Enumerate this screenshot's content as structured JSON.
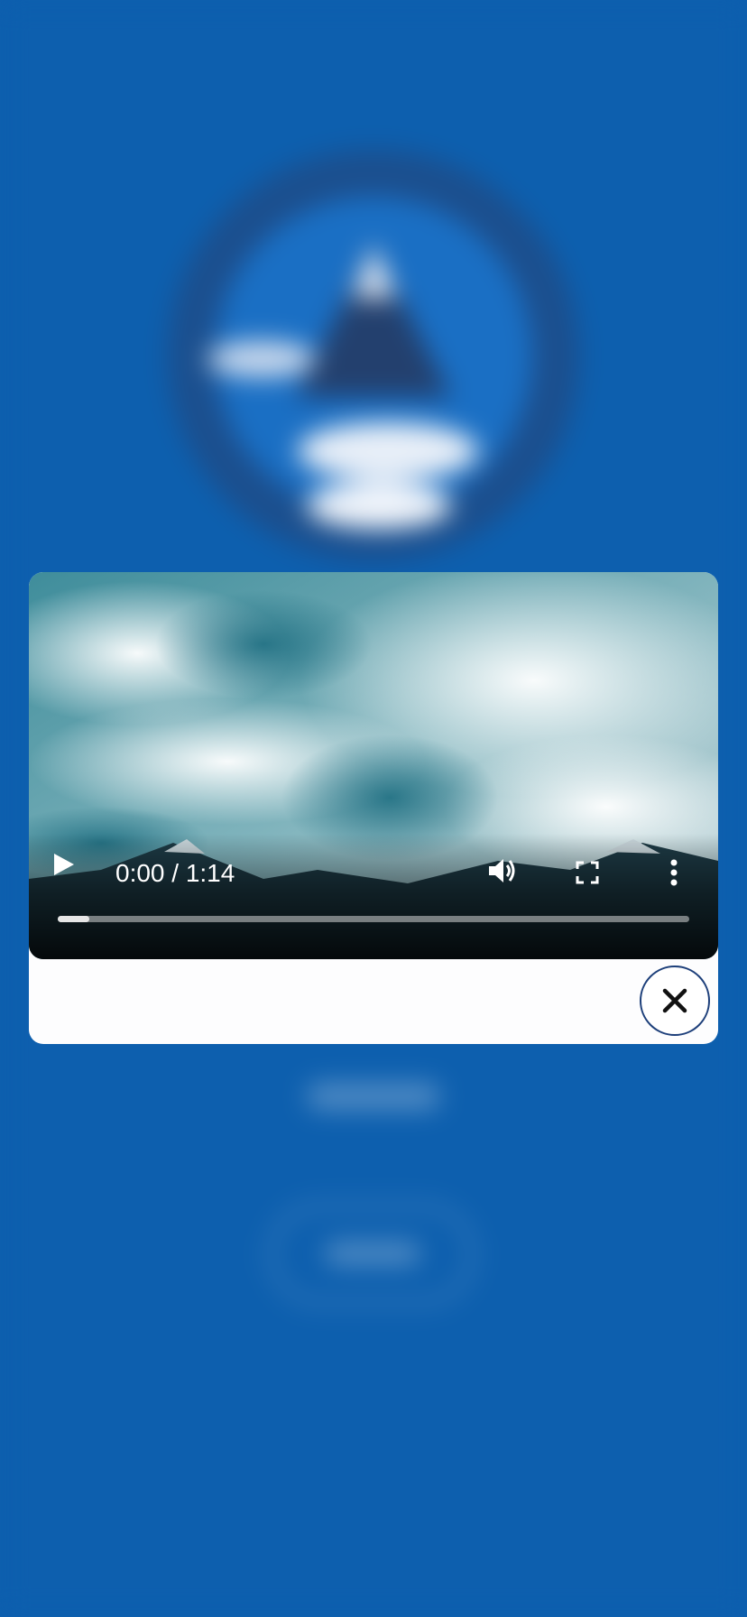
{
  "video_player": {
    "time_display": "0:00 / 1:14",
    "progress": 0.05,
    "controls": {
      "play": "play-icon",
      "volume": "volume-icon",
      "fullscreen": "fullscreen-icon",
      "more": "more-vertical-icon"
    }
  },
  "modal": {
    "close_icon": "close-icon"
  },
  "colors": {
    "background": "#0d5fae",
    "modal_background": "#fdfdfe",
    "close_border": "#1d3f7a"
  }
}
